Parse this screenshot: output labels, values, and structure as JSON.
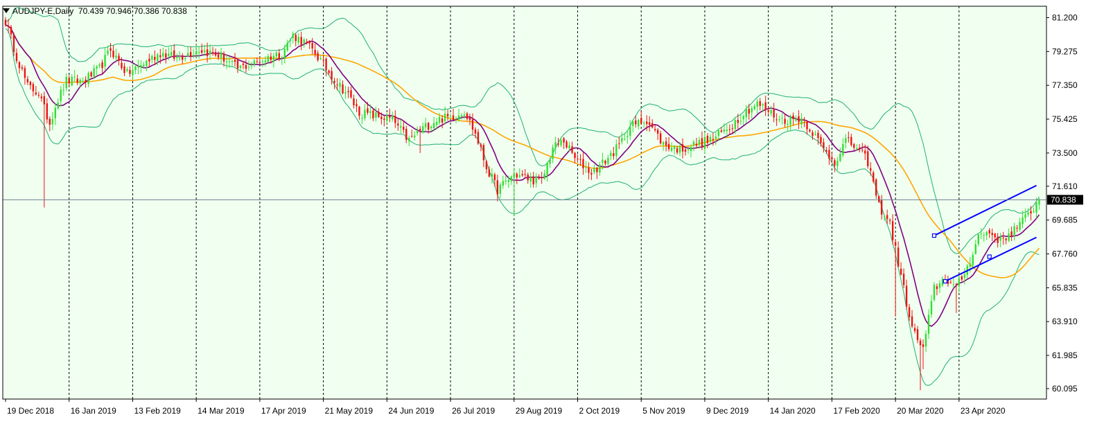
{
  "header": {
    "symbol_label": "AUDJPY-E,Daily",
    "ohlc": "70.439 70.946 70.386 70.838"
  },
  "current_price": {
    "value": 70.838,
    "label": "70.838"
  },
  "colors": {
    "background": "#F0FFF0",
    "frame": "#000000",
    "bull_candle": "#33DD33",
    "bear_candle": "#EE1111",
    "ma_fast": "#800080",
    "ma_slow": "#FFA500",
    "bollinger": "#20B070",
    "channel": "#0000FF",
    "price_line": "#708090"
  },
  "chart_data": {
    "type": "candlestick",
    "symbol": "AUDJPY-E",
    "timeframe": "Daily",
    "ylim": [
      59.5,
      81.85
    ],
    "y_ticks": [
      "81.200",
      "79.275",
      "77.350",
      "75.425",
      "73.500",
      "71.610",
      "69.685",
      "67.760",
      "65.835",
      "63.910",
      "61.985",
      "60.095"
    ],
    "x_ticks": [
      "19 Dec 2018",
      "16 Jan 2019",
      "13 Feb 2019",
      "14 Mar 2019",
      "17 Apr 2019",
      "21 May 2019",
      "24 Jun 2019",
      "26 Jul 2019",
      "29 Aug 2019",
      "2 Oct 2019",
      "5 Nov 2019",
      "9 Dec 2019",
      "14 Jan 2020",
      "17 Feb 2020",
      "20 Mar 2020",
      "23 Apr 2020"
    ],
    "bar_count": 375,
    "bars_per_tick": 23,
    "grid": "vertical dashed at each date label",
    "close_path": [
      [
        0,
        81.0
      ],
      [
        4,
        79.0
      ],
      [
        8,
        77.3
      ],
      [
        12,
        76.9
      ],
      [
        14,
        76.0
      ],
      [
        16,
        75.2
      ],
      [
        18,
        76.2
      ],
      [
        22,
        77.6
      ],
      [
        28,
        77.6
      ],
      [
        34,
        78.3
      ],
      [
        38,
        79.4
      ],
      [
        44,
        78.0
      ],
      [
        50,
        78.6
      ],
      [
        56,
        79.2
      ],
      [
        62,
        78.9
      ],
      [
        70,
        79.4
      ],
      [
        78,
        79.0
      ],
      [
        84,
        78.3
      ],
      [
        90,
        78.6
      ],
      [
        96,
        79.0
      ],
      [
        100,
        79.2
      ],
      [
        104,
        80.2
      ],
      [
        108,
        79.8
      ],
      [
        112,
        79.2
      ],
      [
        116,
        78.3
      ],
      [
        120,
        77.5
      ],
      [
        124,
        76.8
      ],
      [
        128,
        75.8
      ],
      [
        134,
        75.6
      ],
      [
        140,
        75.4
      ],
      [
        146,
        74.2
      ],
      [
        150,
        74.8
      ],
      [
        156,
        75.4
      ],
      [
        162,
        75.6
      ],
      [
        166,
        75.9
      ],
      [
        170,
        74.6
      ],
      [
        174,
        72.7
      ],
      [
        178,
        71.4
      ],
      [
        184,
        72.3
      ],
      [
        190,
        72.0
      ],
      [
        194,
        71.9
      ],
      [
        198,
        73.8
      ],
      [
        202,
        74.2
      ],
      [
        206,
        73.2
      ],
      [
        212,
        72.4
      ],
      [
        216,
        72.9
      ],
      [
        222,
        73.9
      ],
      [
        226,
        75.0
      ],
      [
        232,
        75.4
      ],
      [
        238,
        74.0
      ],
      [
        244,
        73.7
      ],
      [
        250,
        74.0
      ],
      [
        256,
        74.3
      ],
      [
        262,
        75.0
      ],
      [
        268,
        75.9
      ],
      [
        272,
        76.3
      ],
      [
        276,
        75.9
      ],
      [
        280,
        75.4
      ],
      [
        284,
        75.4
      ],
      [
        288,
        75.5
      ],
      [
        292,
        74.7
      ],
      [
        296,
        73.7
      ],
      [
        300,
        73.0
      ],
      [
        304,
        74.2
      ],
      [
        308,
        73.8
      ],
      [
        312,
        73.0
      ],
      [
        316,
        70.5
      ],
      [
        320,
        69.5
      ],
      [
        324,
        66.5
      ],
      [
        328,
        63.5
      ],
      [
        332,
        62.3
      ],
      [
        336,
        65.8
      ],
      [
        340,
        66.4
      ],
      [
        344,
        65.8
      ],
      [
        348,
        67.0
      ],
      [
        352,
        68.8
      ],
      [
        356,
        69.0
      ],
      [
        360,
        68.5
      ],
      [
        364,
        69.0
      ],
      [
        368,
        69.6
      ],
      [
        372,
        70.4
      ],
      [
        374,
        70.838
      ]
    ],
    "spikes": [
      {
        "bar": 14,
        "low": 70.4
      },
      {
        "bar": 150,
        "low": 73.5
      },
      {
        "bar": 184,
        "low": 69.9
      },
      {
        "bar": 322,
        "low": 64.2
      },
      {
        "bar": 331,
        "low": 60.0
      },
      {
        "bar": 332,
        "low": 61.2
      },
      {
        "bar": 344,
        "low": 64.4
      }
    ],
    "indicators": {
      "ma_fast_period": 10,
      "ma_slow_period": 40,
      "bollinger_period": 20,
      "bollinger_deviation": 2
    },
    "channel": {
      "upper": [
        [
          336,
          68.8
        ],
        [
          373,
          71.65
        ]
      ],
      "lower": [
        [
          340,
          66.2
        ],
        [
          373,
          68.7
        ]
      ],
      "anchor_points": [
        [
          336,
          68.8
        ],
        [
          340,
          66.2
        ],
        [
          356,
          67.6
        ]
      ]
    }
  }
}
